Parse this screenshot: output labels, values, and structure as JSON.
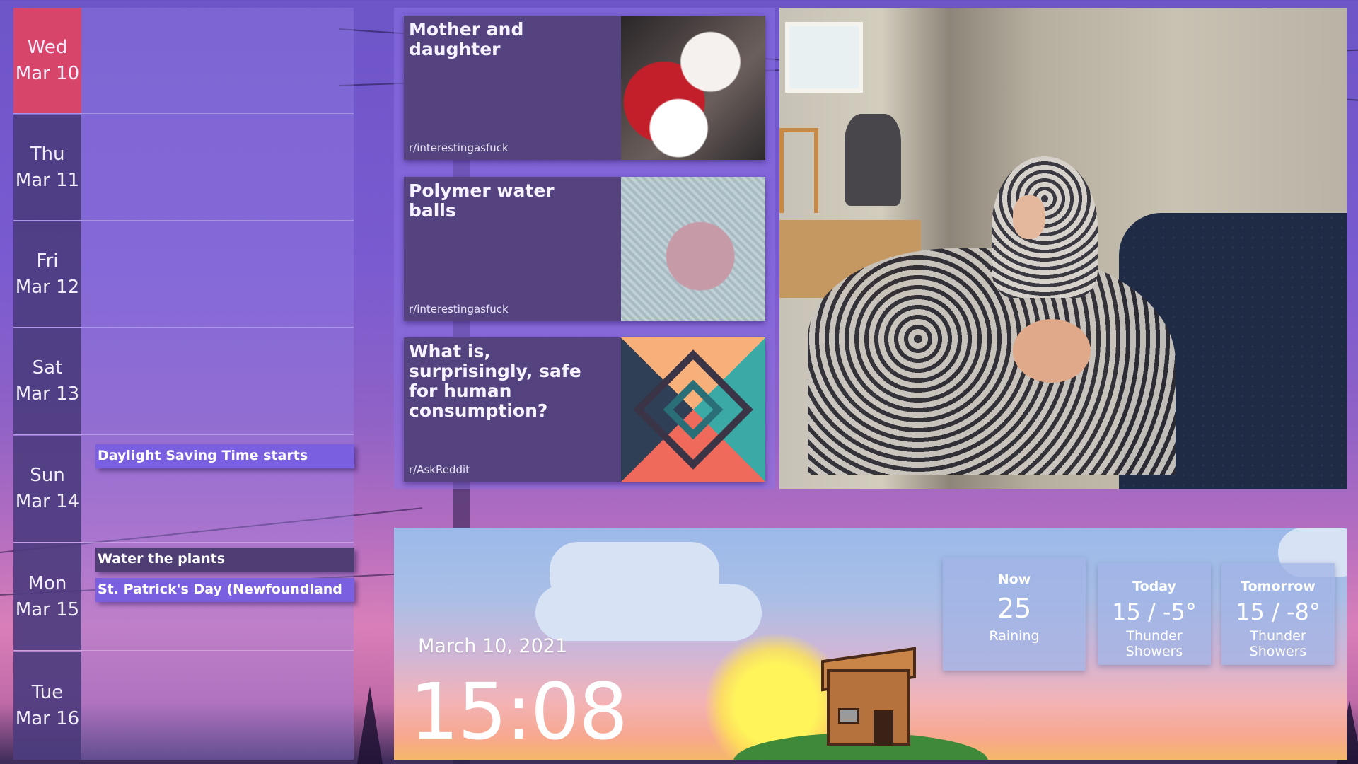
{
  "calendar": {
    "days": [
      {
        "weekday": "Wed",
        "date": "Mar 10"
      },
      {
        "weekday": "Thu",
        "date": "Mar 11"
      },
      {
        "weekday": "Fri",
        "date": "Mar 12"
      },
      {
        "weekday": "Sat",
        "date": "Mar 13"
      },
      {
        "weekday": "Sun",
        "date": "Mar 14"
      },
      {
        "weekday": "Mon",
        "date": "Mar 15"
      },
      {
        "weekday": "Tue",
        "date": "Mar 16"
      }
    ],
    "events": {
      "sun": "Daylight Saving Time starts",
      "mon_1": "Water the plants",
      "mon_2": "St. Patrick's Day (Newfoundland"
    },
    "colors": {
      "today": "#d8456a",
      "event_holiday": "#7a5fe0",
      "event_task": "#4e3e74"
    }
  },
  "reddit": {
    "posts": [
      {
        "title": "Mother and daughter",
        "subreddit": "r/interestingasfuck",
        "thumbnail_icon": "cats-photo"
      },
      {
        "title": "Polymer water balls",
        "subreddit": "r/interestingasfuck",
        "thumbnail_icon": "water-balls-photo"
      },
      {
        "title": "What is, surprisingly, safe for human consumption?",
        "subreddit": "r/AskReddit",
        "thumbnail_icon": "geometric-art"
      }
    ]
  },
  "clock": {
    "date": "March 10, 2021",
    "time": "15:08"
  },
  "weather": {
    "now": {
      "label": "Now",
      "value": "25",
      "condition": "Raining"
    },
    "today": {
      "label": "Today",
      "value": "15 / -5°",
      "condition": "Thunder Showers"
    },
    "tomorrow": {
      "label": "Tomorrow",
      "value": "15 / -8°",
      "condition": "Thunder Showers"
    }
  }
}
